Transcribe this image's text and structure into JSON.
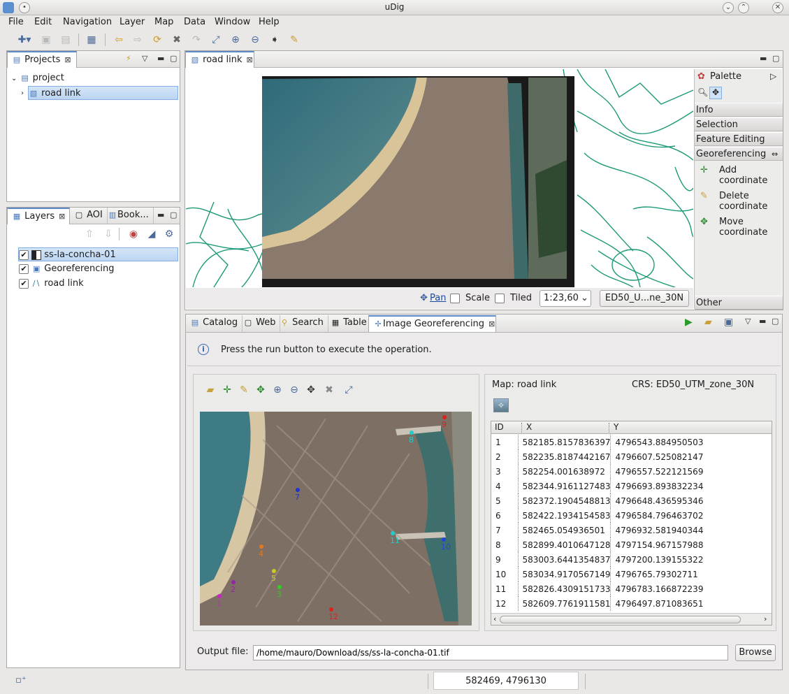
{
  "window": {
    "title": "uDig"
  },
  "menu": [
    "File",
    "Edit",
    "Navigation",
    "Layer",
    "Map",
    "Data",
    "Window",
    "Help"
  ],
  "projects_view": {
    "tab_label": "Projects",
    "tree": {
      "project": "project",
      "map": "road link"
    }
  },
  "layers_view": {
    "tabs": [
      "Layers",
      "AOI",
      "Book..."
    ],
    "layers": [
      {
        "name": "ss-la-concha-01",
        "checked": true,
        "selected": true
      },
      {
        "name": "Georeferencing",
        "checked": true,
        "selected": false
      },
      {
        "name": "road link",
        "checked": true,
        "selected": false
      }
    ]
  },
  "map_editor": {
    "tab_label": "road link",
    "status": {
      "pan": "Pan",
      "scale_label": "Scale",
      "tiled_label": "Tiled",
      "scale_value": "1:23,60",
      "crs": "ED50_U...ne_30N"
    }
  },
  "palette": {
    "title": "Palette",
    "sections": [
      "Info",
      "Selection",
      "Feature Editing",
      "Georeferencing",
      "Other"
    ],
    "tools": [
      {
        "line1": "Add",
        "line2": "coordinate"
      },
      {
        "line1": "Delete",
        "line2": "coordinate"
      },
      {
        "line1": "Move",
        "line2": "coordinate"
      }
    ]
  },
  "bottom_tabs": [
    "Catalog",
    "Web",
    "Search",
    "Table",
    "Image Georeferencing"
  ],
  "georef": {
    "message": "Press the run button to execute the operation.",
    "map_label": "Map: road link",
    "crs_label": "CRS: ED50_UTM_zone_30N",
    "columns": [
      "ID",
      "X",
      "Y"
    ],
    "rows": [
      [
        "1",
        "582185.8157836397",
        "4796543.884950503"
      ],
      [
        "2",
        "582235.8187442167",
        "4796607.525082147"
      ],
      [
        "3",
        "582254.001638972",
        "4796557.522121569"
      ],
      [
        "4",
        "582344.9161127483",
        "4796693.893832234"
      ],
      [
        "5",
        "582372.1904548813",
        "4796648.436595346"
      ],
      [
        "6",
        "582422.1934154583",
        "4796584.796463702"
      ],
      [
        "7",
        "582465.054936501",
        "4796932.581940344"
      ],
      [
        "8",
        "582899.4010647128",
        "4797154.967157988"
      ],
      [
        "9",
        "583003.6441354837",
        "4797200.139155322"
      ],
      [
        "10",
        "583034.9170567149",
        "4796765.79302711"
      ],
      [
        "11",
        "582826.4309151733",
        "4796783.166872239"
      ],
      [
        "12",
        "582609.7761911581",
        "4796497.871083651"
      ]
    ],
    "output_label": "Output file:",
    "output_value": "/home/mauro/Download/ss/ss-la-concha-01.tif",
    "browse": "Browse",
    "markers": [
      {
        "id": "1",
        "color": "#cc22cc"
      },
      {
        "id": "2",
        "color": "#9922aa"
      },
      {
        "id": "3",
        "color": "#33cc22"
      },
      {
        "id": "4",
        "color": "#e07a22"
      },
      {
        "id": "5",
        "color": "#cccc22"
      },
      {
        "id": "7",
        "color": "#2233cc"
      },
      {
        "id": "8",
        "color": "#22cccc"
      },
      {
        "id": "9",
        "color": "#dd2222"
      },
      {
        "id": "10",
        "color": "#2244dd"
      },
      {
        "id": "11",
        "color": "#22cccc"
      },
      {
        "id": "12",
        "color": "#dd2222"
      }
    ]
  },
  "statusbar": {
    "coords": "582469, 4796130"
  }
}
